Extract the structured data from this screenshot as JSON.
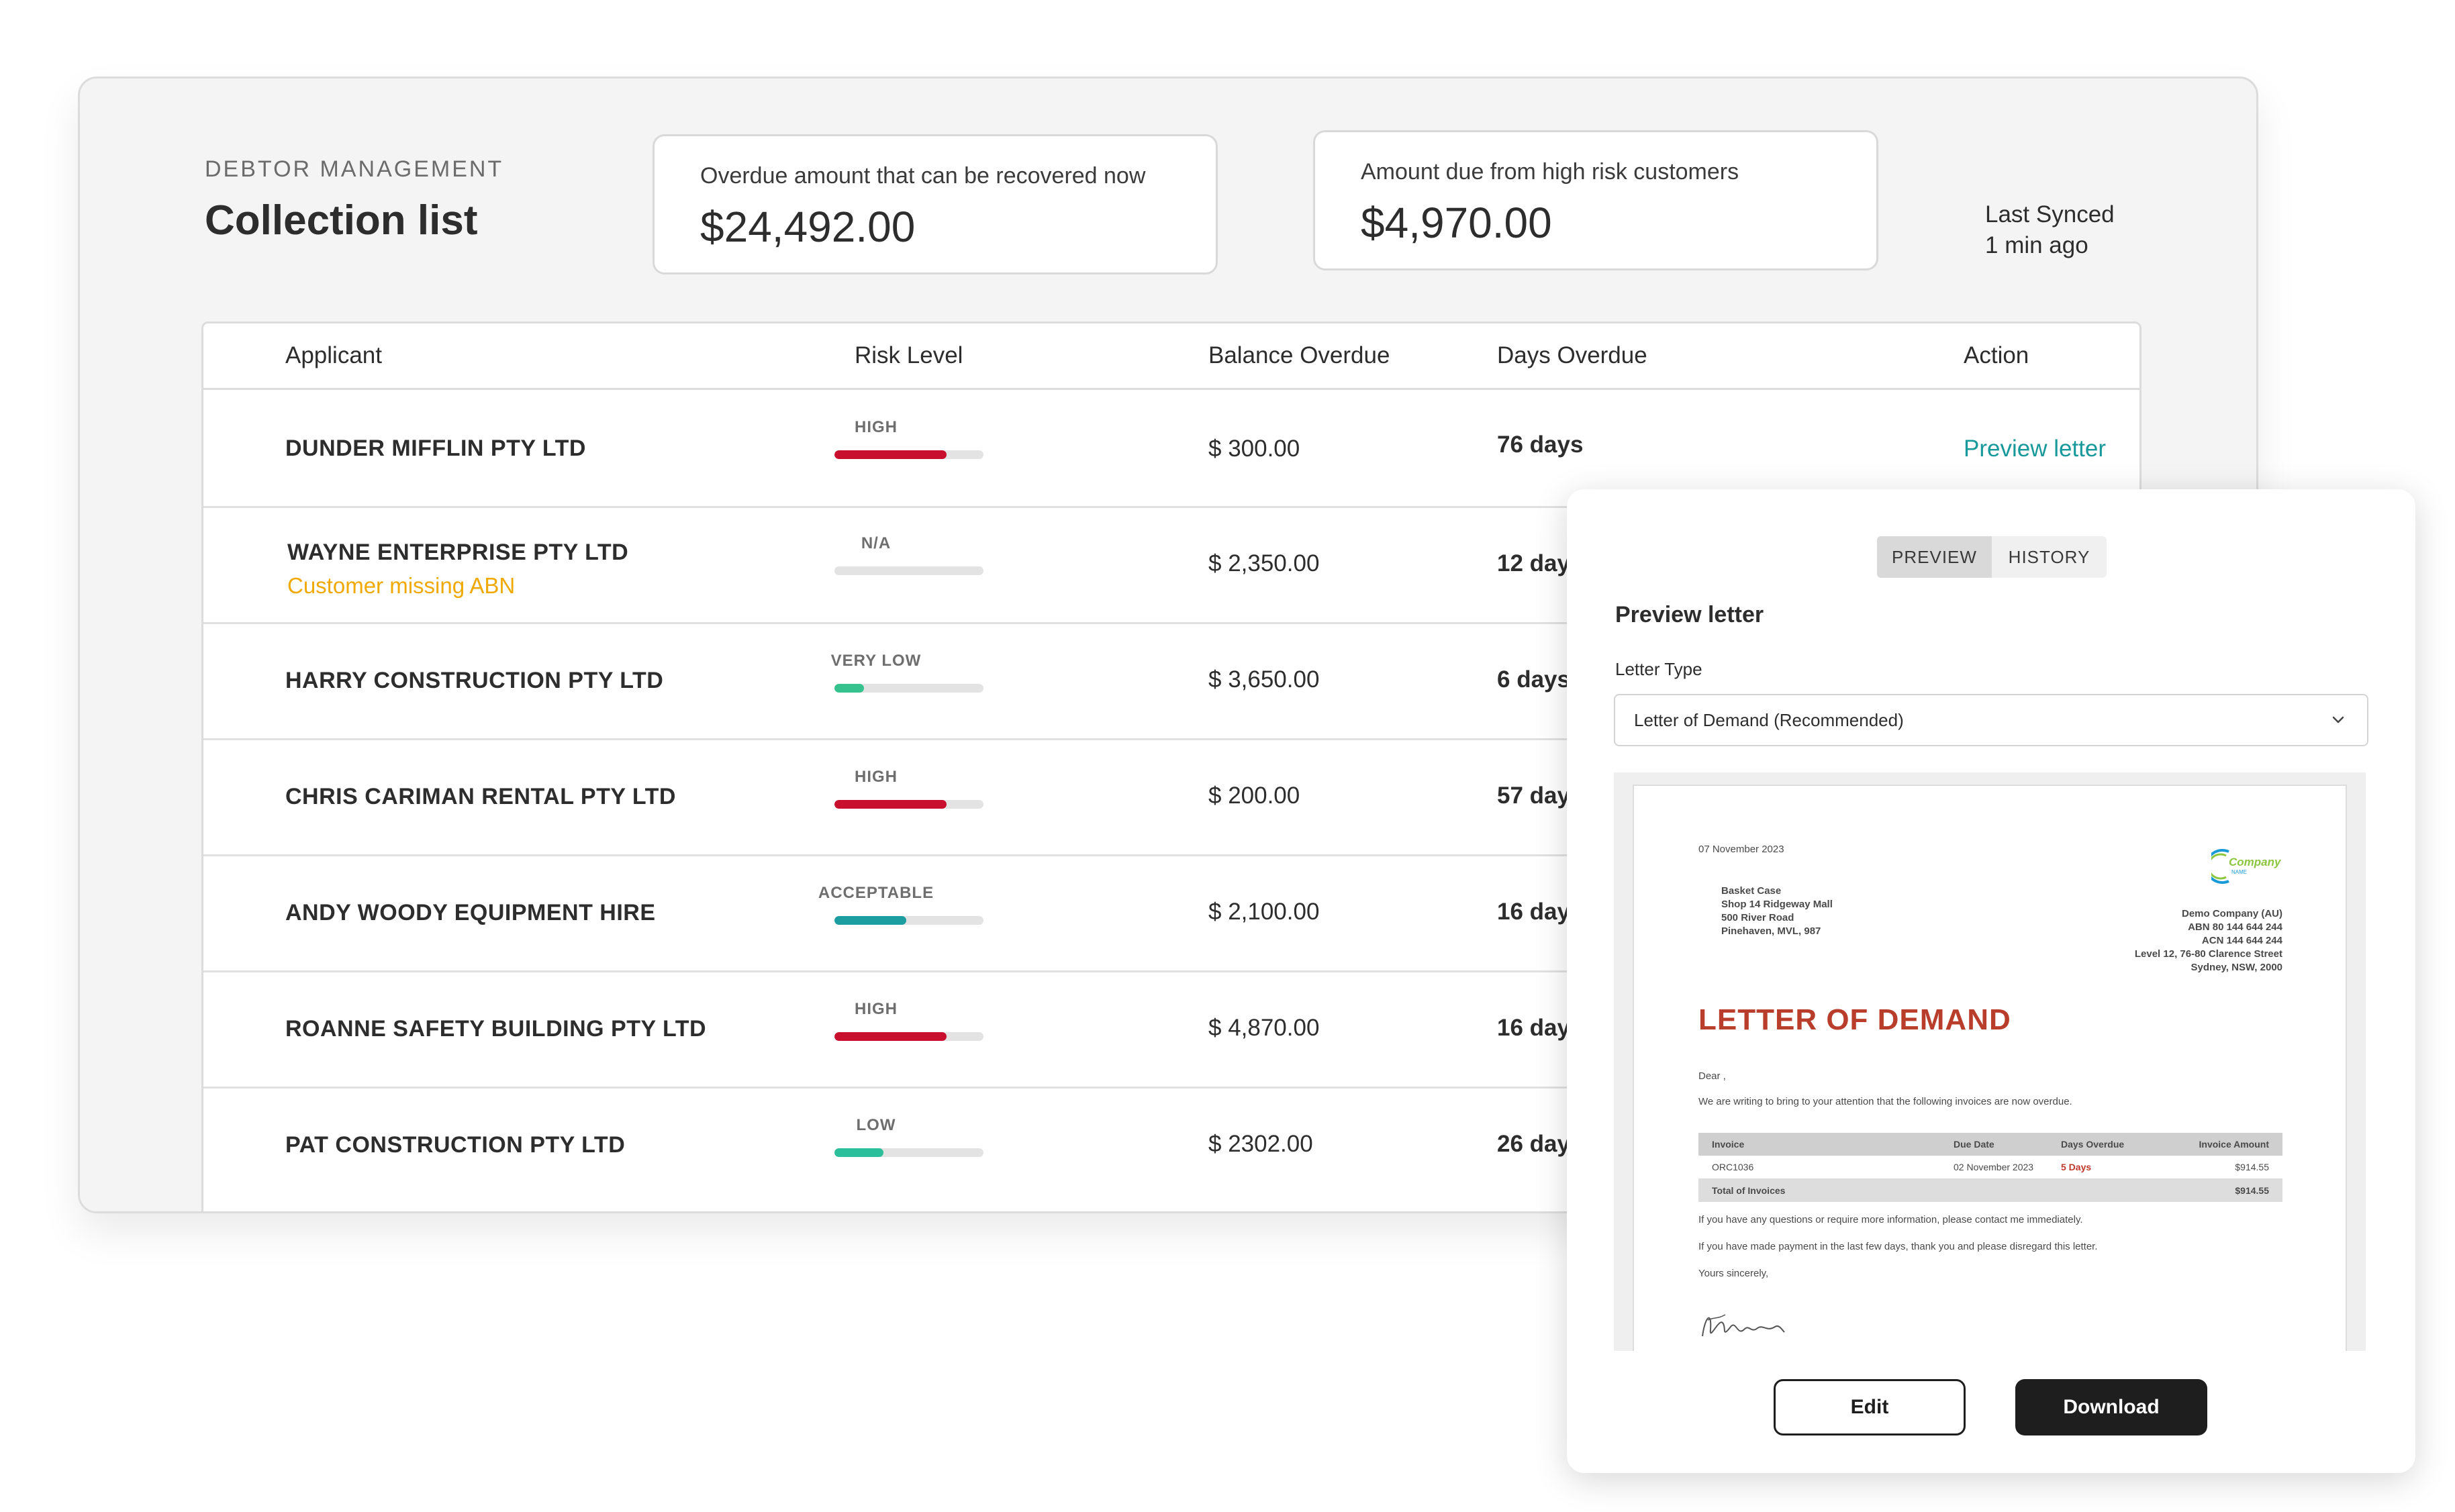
{
  "header": {
    "kicker": "DEBTOR MANAGEMENT",
    "title": "Collection list"
  },
  "stats": [
    {
      "label": "Overdue amount that can be recovered now",
      "value": "$24,492.00"
    },
    {
      "label": "Amount due from high risk customers",
      "value": "$4,970.00"
    }
  ],
  "sync": {
    "line1": "Last Synced",
    "line2": "1 min ago"
  },
  "table": {
    "columns": [
      "Applicant",
      "Risk Level",
      "Balance Overdue",
      "Days Overdue",
      "Action"
    ],
    "rows": [
      {
        "applicant": "DUNDER MIFFLIN PTY LTD",
        "warning": "",
        "risk": "HIGH",
        "risk_level": 0.75,
        "risk_color": "#c8102e",
        "balance": "$ 300.00",
        "days": "76 days",
        "action": "Preview letter"
      },
      {
        "applicant": "WAYNE ENTERPRISE PTY LTD",
        "warning": "Customer missing ABN",
        "risk": "N/A",
        "risk_level": 0,
        "risk_color": "#c8c8c8",
        "balance": "$ 2,350.00",
        "days": "12 days",
        "action": ""
      },
      {
        "applicant": "HARRY CONSTRUCTION PTY LTD",
        "warning": "",
        "risk": "VERY LOW",
        "risk_level": 0.2,
        "risk_color": "#35c28f",
        "balance": "$ 3,650.00",
        "days": "6 days",
        "action": ""
      },
      {
        "applicant": "CHRIS CARIMAN RENTAL PTY LTD",
        "warning": "",
        "risk": "HIGH",
        "risk_level": 0.75,
        "risk_color": "#c8102e",
        "balance": "$ 200.00",
        "days": "57 days",
        "action": ""
      },
      {
        "applicant": "ANDY WOODY EQUIPMENT HIRE",
        "warning": "",
        "risk": "ACCEPTABLE",
        "risk_level": 0.48,
        "risk_color": "#1c9ea1",
        "balance": "$ 2,100.00",
        "days": "16 days",
        "action": ""
      },
      {
        "applicant": "ROANNE SAFETY BUILDING PTY LTD",
        "warning": "",
        "risk": "HIGH",
        "risk_level": 0.75,
        "risk_color": "#c8102e",
        "balance": "$ 4,870.00",
        "days": "16 days",
        "action": ""
      },
      {
        "applicant": "PAT CONSTRUCTION PTY LTD",
        "warning": "",
        "risk": "LOW",
        "risk_level": 0.33,
        "risk_color": "#2bbf9c",
        "balance": "$ 2302.00",
        "days": "26 days",
        "action": ""
      }
    ]
  },
  "panel": {
    "tabs": [
      "PREVIEW",
      "HISTORY"
    ],
    "active_tab": "PREVIEW",
    "title": "Preview letter",
    "field_label": "Letter Type",
    "select_value": "Letter of Demand (Recommended)",
    "edit_label": "Edit",
    "download_label": "Download"
  },
  "letter": {
    "date": "07 November 2023",
    "logo_text": "Company",
    "logo_sub": "NAME",
    "recipient": [
      "Basket Case",
      "Shop 14 Ridgeway Mall",
      "500 River Road",
      "Pinehaven, MVL, 987"
    ],
    "sender": [
      "Demo Company (AU)",
      "ABN 80 144 644 244",
      "ACN 144 644 244",
      "Level 12, 76-80 Clarence Street",
      "Sydney, NSW, 2000"
    ],
    "title": "LETTER OF DEMAND",
    "salutation": "Dear ,",
    "intro": "We are writing to bring to your attention that the following invoices are now overdue.",
    "inv_headers": [
      "Invoice",
      "Due Date",
      "Days Overdue",
      "Invoice Amount"
    ],
    "inv_row": [
      "ORC1036",
      "02 November 2023",
      "5 Days",
      "$914.55"
    ],
    "total_label": "Total of Invoices",
    "total_value": "$914.55",
    "para1": "If you have any questions or require more information, please contact me immediately.",
    "para2": "If you have made payment in the last few days, thank you and please disregard this letter.",
    "closing": "Yours sincerely,"
  },
  "colors": {
    "accent": "#17999b",
    "warning": "#f0a900",
    "high": "#c8102e",
    "letter_title": "#b83d2a"
  }
}
